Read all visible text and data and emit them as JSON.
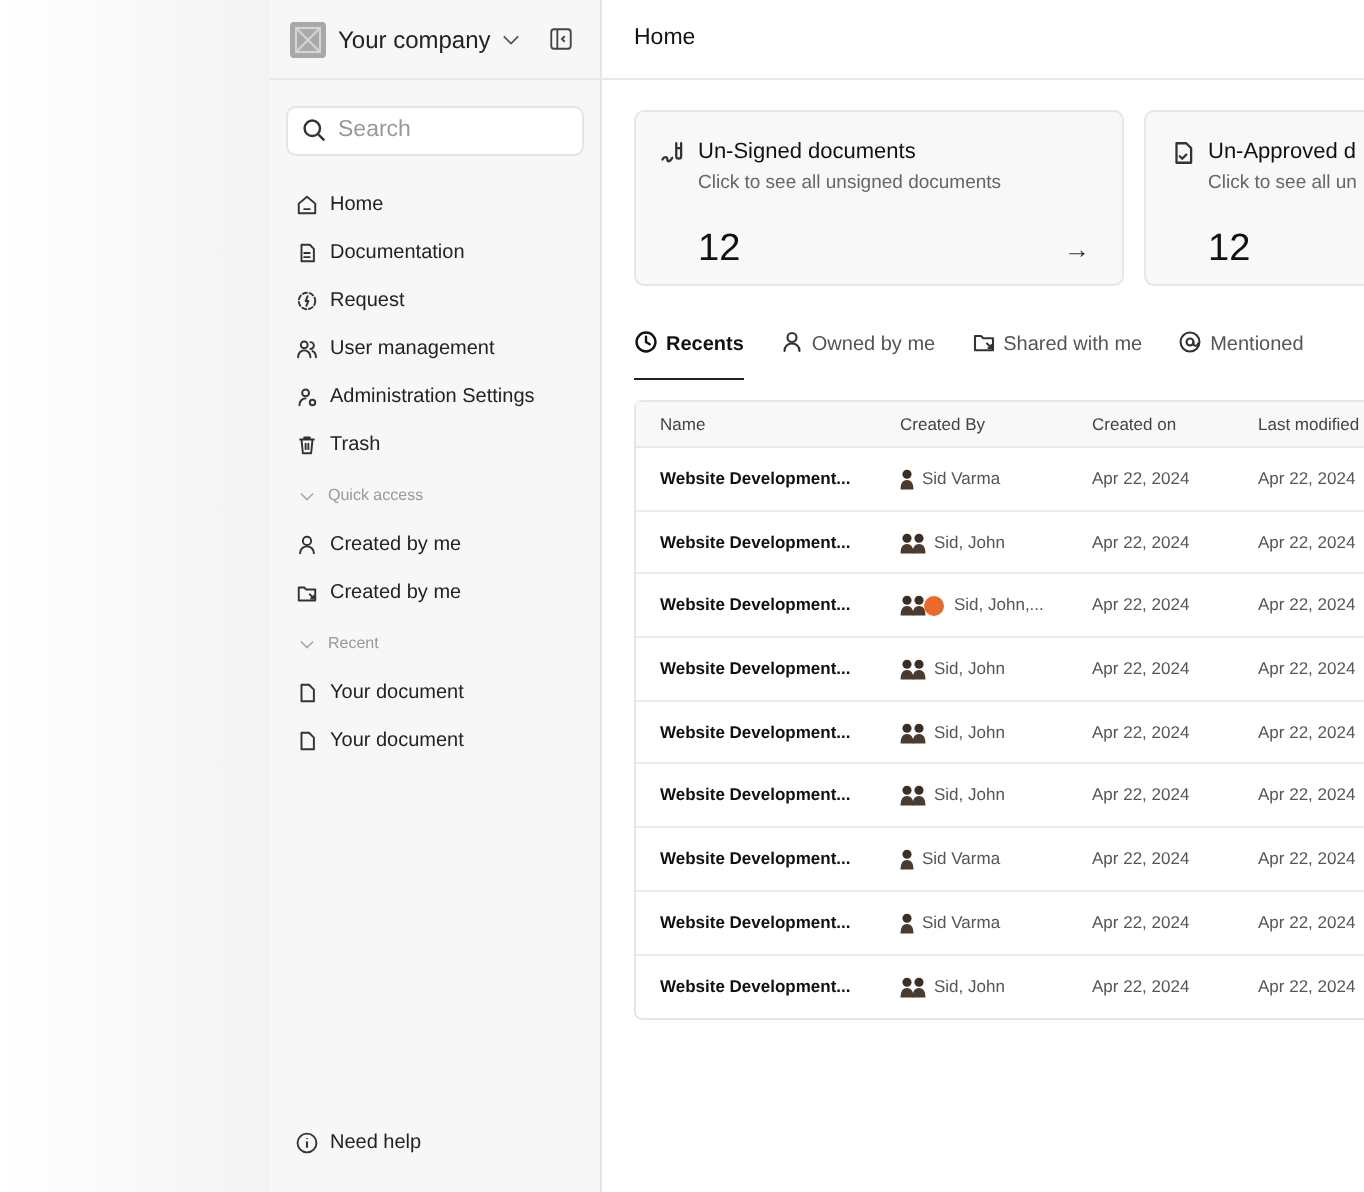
{
  "sidebar": {
    "company": "Your company",
    "search": {
      "placeholder": "Search"
    },
    "items": [
      {
        "label": "Home",
        "kind": "home"
      },
      {
        "label": "Documentation",
        "kind": "doc"
      },
      {
        "label": "Request",
        "kind": "request"
      },
      {
        "label": "User management",
        "kind": "users"
      },
      {
        "label": "Administration Settings",
        "kind": "admin"
      },
      {
        "label": "Trash",
        "kind": "trash"
      }
    ],
    "sections": [
      {
        "title": "Quick access",
        "expanded": true,
        "items": [
          {
            "label": "Created by me",
            "kind": "user"
          },
          {
            "label": "Created by me",
            "kind": "folder"
          }
        ]
      },
      {
        "title": "Recent",
        "expanded": true,
        "items": [
          {
            "label": "Your document",
            "kind": "file"
          },
          {
            "label": "Your document",
            "kind": "file"
          }
        ]
      }
    ],
    "help": "Need help"
  },
  "header": {
    "title": "Home"
  },
  "cards": [
    {
      "title": "Un-Signed documents",
      "subtitle": "Click to see all unsigned documents",
      "count": "12",
      "kind": "sign",
      "arrow": "→"
    },
    {
      "title": "Un-Approved d",
      "subtitle": "Click to see all un",
      "count": "12",
      "kind": "approve"
    }
  ],
  "tabs": [
    {
      "label": "Recents",
      "kind": "clock",
      "selected": true
    },
    {
      "label": "Owned by me",
      "kind": "user",
      "selected": false
    },
    {
      "label": "Shared with me",
      "kind": "folder",
      "selected": false
    },
    {
      "label": "Mentioned",
      "kind": "at",
      "selected": false
    }
  ],
  "table": {
    "columns": [
      "Name",
      "Created By",
      "Created on",
      "Last modified"
    ],
    "rows": [
      {
        "name": "Website Development...",
        "avatars": [
          {
            "kind": "person"
          }
        ],
        "created_by": "Sid Varma",
        "created_on": "Apr 22, 2024",
        "last_modified": "Apr 22, 2024"
      },
      {
        "name": "Website Development...",
        "avatars": [
          {
            "kind": "person"
          },
          {
            "kind": "person"
          }
        ],
        "created_by": "Sid, John",
        "created_on": "Apr 22, 2024",
        "last_modified": "Apr 22, 2024"
      },
      {
        "name": "Website Development...",
        "avatars": [
          {
            "kind": "person"
          },
          {
            "kind": "person"
          },
          {
            "kind": "more"
          }
        ],
        "created_by": "Sid, John,...",
        "created_on": "Apr 22, 2024",
        "last_modified": "Apr 22, 2024"
      },
      {
        "name": "Website Development...",
        "avatars": [
          {
            "kind": "person"
          },
          {
            "kind": "person"
          }
        ],
        "created_by": "Sid, John",
        "created_on": "Apr 22, 2024",
        "last_modified": "Apr 22, 2024"
      },
      {
        "name": "Website Development...",
        "avatars": [
          {
            "kind": "person"
          },
          {
            "kind": "person"
          }
        ],
        "created_by": "Sid, John",
        "created_on": "Apr 22, 2024",
        "last_modified": "Apr 22, 2024"
      },
      {
        "name": "Website Development...",
        "avatars": [
          {
            "kind": "person"
          },
          {
            "kind": "person"
          }
        ],
        "created_by": "Sid, John",
        "created_on": "Apr 22, 2024",
        "last_modified": "Apr 22, 2024"
      },
      {
        "name": "Website Development...",
        "avatars": [
          {
            "kind": "person"
          }
        ],
        "created_by": "Sid Varma",
        "created_on": "Apr 22, 2024",
        "last_modified": "Apr 22, 2024"
      },
      {
        "name": "Website Development...",
        "avatars": [
          {
            "kind": "person"
          }
        ],
        "created_by": "Sid Varma",
        "created_on": "Apr 22, 2024",
        "last_modified": "Apr 22, 2024"
      },
      {
        "name": "Website Development...",
        "avatars": [
          {
            "kind": "person"
          },
          {
            "kind": "person"
          }
        ],
        "created_by": "Sid, John",
        "created_on": "Apr 22, 2024",
        "last_modified": "Apr 22, 2024"
      }
    ]
  }
}
